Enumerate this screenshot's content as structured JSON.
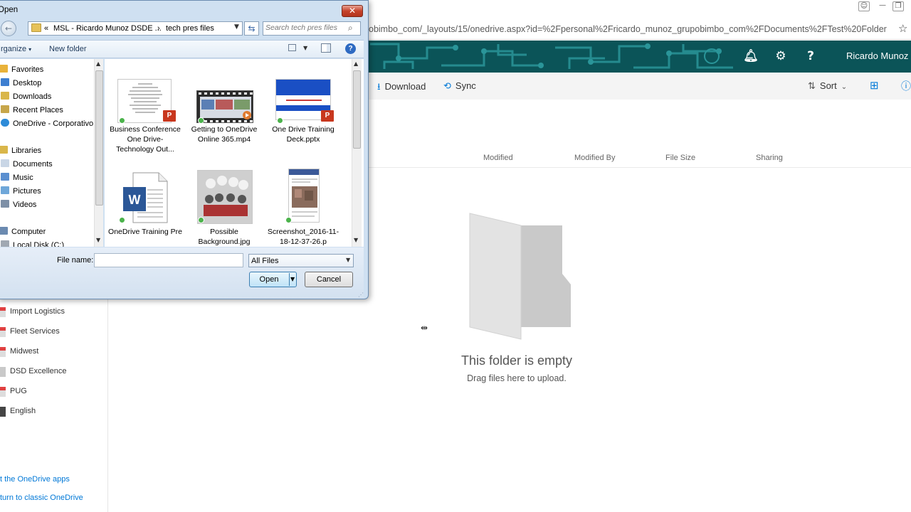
{
  "browser": {
    "url": "obimbo_com/_layouts/15/onedrive.aspx?id=%2Fpersonal%2Fricardo_munoz_grupobimbo_com%2FDocuments%2FTest%20Folder",
    "icons": [
      "user-icon",
      "minimize-icon",
      "restore-icon",
      "star-icon"
    ]
  },
  "onedrive": {
    "header": {
      "user_name": "Ricardo Munoz",
      "icons": [
        "bell-icon",
        "gear-icon",
        "help-icon"
      ],
      "colors": {
        "suite_bar": "#0b5458",
        "circuit": "#1f8b8f"
      }
    },
    "commands": {
      "download": "Download",
      "sync": "Sync",
      "sort": "Sort"
    },
    "columns": [
      "Modified",
      "Modified By",
      "File Size",
      "Sharing"
    ],
    "empty_state": {
      "title": "This folder is empty",
      "subtitle": "Drag files here to upload."
    },
    "nav": {
      "items": [
        "Import Logistics",
        "Fleet Services",
        "Midwest",
        "DSD Excellence",
        "PUG",
        "English"
      ],
      "links": [
        "t the OneDrive apps",
        "turn to classic OneDrive"
      ]
    }
  },
  "dialog": {
    "title": "Open",
    "path": {
      "prefix": "«",
      "crumbs": [
        "MSL - Ricardo Munoz DSDE ...",
        "tech pres files"
      ],
      "separator": "›"
    },
    "search_placeholder": "Search tech pres files",
    "toolbar": {
      "organize": "rganize",
      "new_folder": "New folder"
    },
    "nav_pane": {
      "favorites": "Favorites",
      "desktop": "Desktop",
      "downloads": "Downloads",
      "recent": "Recent Places",
      "onedrive": "OneDrive - Corporativo B",
      "libraries": "Libraries",
      "documents": "Documents",
      "music": "Music",
      "pictures": "Pictures",
      "videos": "Videos",
      "computer": "Computer",
      "local_disk": "Local Disk (C:)"
    },
    "files": [
      {
        "name": "Business Conference One Drive- Technology Out...",
        "type": "pptx"
      },
      {
        "name": "Getting to OneDrive Online 365.mp4",
        "type": "mp4"
      },
      {
        "name": "One Drive Training Deck.pptx",
        "type": "pptx"
      },
      {
        "name": "OneDrive Training Pre",
        "type": "docx"
      },
      {
        "name": "Possible Background.jpg",
        "type": "jpg"
      },
      {
        "name": "Screenshot_2016-11-18-12-37-26.p",
        "type": "png"
      }
    ],
    "file_name_label": "File name:",
    "file_name_value": "",
    "filter": "All Files",
    "open": "Open",
    "cancel": "Cancel"
  }
}
